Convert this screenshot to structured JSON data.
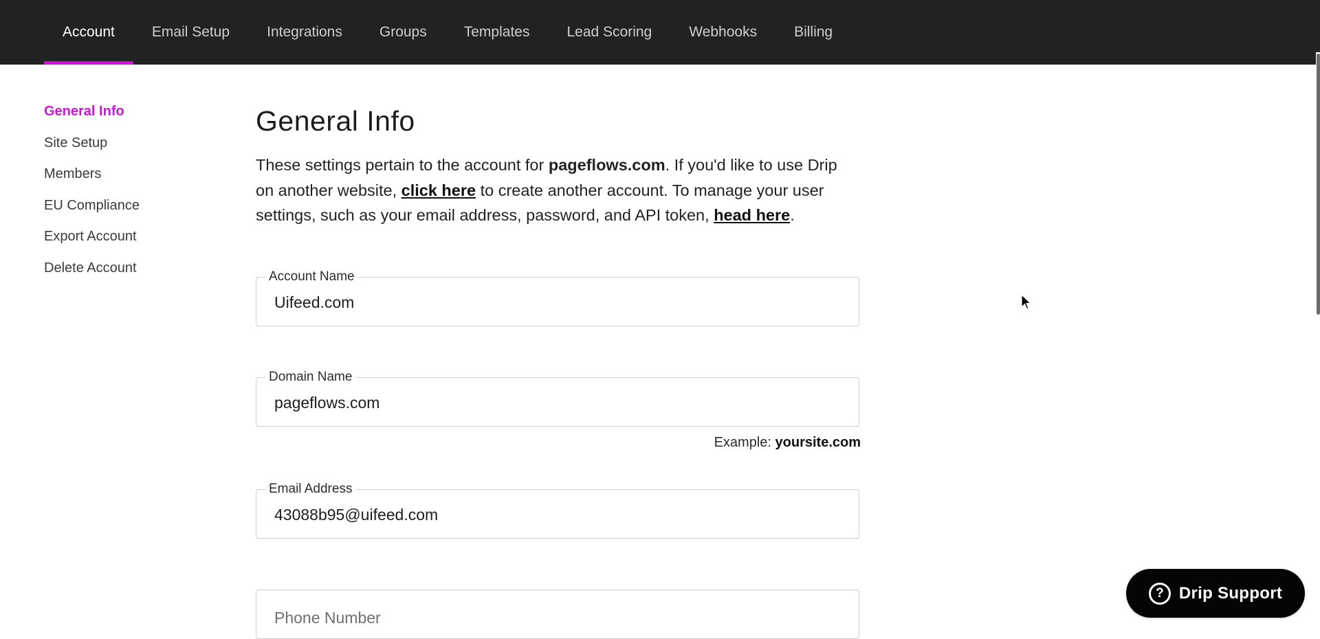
{
  "topnav": {
    "tabs": [
      {
        "label": "Account",
        "active": true
      },
      {
        "label": "Email Setup",
        "active": false
      },
      {
        "label": "Integrations",
        "active": false
      },
      {
        "label": "Groups",
        "active": false
      },
      {
        "label": "Templates",
        "active": false
      },
      {
        "label": "Lead Scoring",
        "active": false
      },
      {
        "label": "Webhooks",
        "active": false
      },
      {
        "label": "Billing",
        "active": false
      }
    ],
    "accent_color": "#d010d8"
  },
  "sidenav": {
    "items": [
      {
        "label": "General Info",
        "active": true
      },
      {
        "label": "Site Setup",
        "active": false
      },
      {
        "label": "Members",
        "active": false
      },
      {
        "label": "EU Compliance",
        "active": false
      },
      {
        "label": "Export Account",
        "active": false
      },
      {
        "label": "Delete Account",
        "active": false
      }
    ]
  },
  "main": {
    "title": "General Info",
    "intro": {
      "part1": "These settings pertain to the account for ",
      "domain": "pageflows.com",
      "part2": ". If you'd like to use Drip on another website, ",
      "link1": "click here",
      "part3": " to create another account. To manage your user settings, such as your email address, password, and API token, ",
      "link2": "head here",
      "part4": "."
    },
    "fields": {
      "account_name": {
        "label": "Account Name",
        "value": "Uifeed.com"
      },
      "domain_name": {
        "label": "Domain Name",
        "value": "pageflows.com"
      },
      "domain_hint": {
        "prefix": "Example: ",
        "example": "yoursite.com"
      },
      "email": {
        "label": "Email Address",
        "value": "43088b95@uifeed.com"
      },
      "phone": {
        "placeholder": "Phone Number",
        "value": ""
      }
    }
  },
  "support": {
    "icon": "question-circle-icon",
    "label": "Drip Support"
  }
}
